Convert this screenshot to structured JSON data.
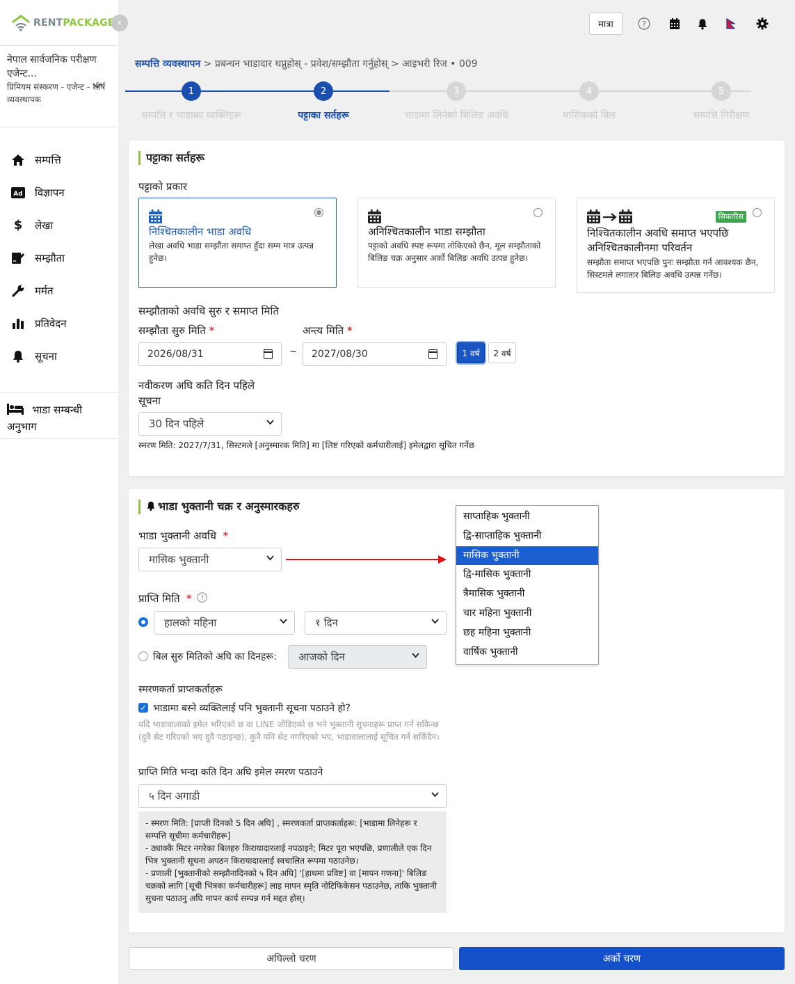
{
  "app": {
    "logo_rent": "RENT",
    "logo_package": "PACKAGE",
    "collapse_glyph": "‹",
    "trip_button": "मात्रा"
  },
  "org": {
    "name": "नेपाल सार्वजनिक परीक्षण एजेन्ट...",
    "plan": "प्रिमियम संस्करण - एजेन्ट - शीर्ष व्यवस्थापक"
  },
  "nav": [
    {
      "label": "सम्पत्ति",
      "icon": "home-icon"
    },
    {
      "label": "विज्ञापन",
      "icon": "ad-icon"
    },
    {
      "label": "लेखा",
      "icon": "dollar-icon"
    },
    {
      "label": "सम्झौता",
      "icon": "contract-icon"
    },
    {
      "label": "मर्मत",
      "icon": "wrench-icon"
    },
    {
      "label": "प्रतिवेदन",
      "icon": "bar-chart-icon"
    },
    {
      "label": "सूचना",
      "icon": "bell-icon"
    }
  ],
  "nav_extra": {
    "label": "भाडा सम्बन्धी अनुभाग",
    "icon": "bed-icon"
  },
  "breadcrumb": {
    "root": "सम्पत्ति व्यवस्थापन",
    "rest": " > प्रबन्धन भाडादार थप्नुहोस् - प्रवेश/सम्झौता गर्नुहोस् > आइभरी रिज • 009"
  },
  "steps": [
    {
      "num": "1",
      "label": "सम्पत्ति र भाडाका व्यक्तिहरू",
      "state": "done"
    },
    {
      "num": "2",
      "label": "पट्टाका सर्तहरू",
      "state": "active"
    },
    {
      "num": "3",
      "label": "भाडामा लिनेको बिलिङ अवधि",
      "state": "pending"
    },
    {
      "num": "4",
      "label": "मासिकको बिल",
      "state": "pending"
    },
    {
      "num": "5",
      "label": "सम्पत्ति निरीक्षण",
      "state": "pending"
    }
  ],
  "lease": {
    "title": "पट्टाका सर्तहरू",
    "type_label": "पट्टाको प्रकार",
    "options": [
      {
        "title": "निश्चितकालीन भाडा अवधि",
        "desc": "लेखा अवधि भाडा सम्झौता समाप्त हुँदा सम्म मात्र उत्पन्न हुनेछ।",
        "selected": true
      },
      {
        "title": "अनिश्चितकालीन भाडा सम्झौता",
        "desc": "पट्टाको अवधि स्पष्ट रूपमा तोकिएको छैन, मूल सम्झौताको बिलिङ चक्र अनुसार अर्को बिलिङ अवधि उत्पन्न हुनेछ।",
        "selected": false
      },
      {
        "title": "निश्चितकालीन अवधि समाप्त भएपछि अनिश्चितकालीनमा परिवर्तन",
        "desc": "सम्झौता समाप्त भएपछि पुनः सम्झौता गर्न आवश्यक छैन, सिस्टमले लगातार बिलिङ अवधि उत्पन्न गर्नेछ।",
        "selected": false,
        "badge": "सिफारिस"
      }
    ],
    "period_label": "सम्झौताको अवधि सुरु र समाप्त मिति",
    "start_label": "सम्झौता सुरु मिति",
    "end_label": "अन्त्य मिति",
    "start_value": "2026/08/31",
    "end_value": "2027/08/30",
    "tilde": "~",
    "year1": "1 वर्ष",
    "year2": "2 वर्ष",
    "renewal_label": "नवीकरण अघि कति दिन पहिले सूचना",
    "renewal_value": "30 दिन पहिले",
    "reminder_note": "स्मरण मिति: 2027/7/31, सिस्टमले [अनुस्मारक मिति] मा [लिष्ट गरिएको कर्मचारीलाई] इमेलद्वारा सूचित गर्नेछ"
  },
  "payment": {
    "title": "भाडा भुक्तानी चक्र र अनुस्मारकहरु",
    "period_label": "भाडा भुक्तानी अवधि",
    "period_value": "मासिक भुक्तानी",
    "receive_label": "प्राप्ति मिति",
    "receive_month": "हालको महिना",
    "receive_day": "१ दिन",
    "before_label": "बिल सुरु मितिको अघि का दिनहरू:",
    "before_value": "आजको दिन",
    "recipients_label": "स्मरणकर्ता प्राप्तकर्ताहरू",
    "notify_tenant": "भाडामा बस्ने व्यक्तिलाई पनि भुक्तानी सूचना पठाउने हो?",
    "notify_help": "यदि भाडावालाको इमेल भरिएको छ वा LINE जोडिएको छ भने भुक्तानी सूचनाहरू प्राप्त गर्न सकिन्छ (दुवै सेट गरिएको भए दुवै पठाइन्छ); कुनै पनि सेट नगरिएको भए, भाडावालालाई सूचित गर्न सकिँदैन।",
    "email_days_label": "प्राप्ति मिति भन्दा कति दिन अघि इमेल स्मरण पठाउने",
    "email_days_value": "५ दिन अगाडी",
    "info_lines": [
      "- स्मरण मिति: [प्राप्ती दिनको 5 दिन अघि] , स्मरणकर्ता प्राप्तकर्ताहरू: [भाडामा लिनेहरू र सम्पत्ति सूचीमा कर्मचारीहरू]",
      "- ठ्याक्कै मिटर नगरेका बिलहरु किरायादारलाई नपठाइने; मिटर पूरा भएपछि, प्रणालीले एक दिन भित्र भुक्तानी सूचना अपठन किरायादारलाई स्वचालित रूपमा पठाउनेछ।",
      "- प्रणाली [भुक्तानीको सम्झौनादिनको ५ दिन अघि] '[हाथमा प्रविष्ट] वा [मापन गणना]' बिलिङ चक्रको लागि [सूची भित्रका कर्मचारीहरू] लाइ मापन स्मृति नोटिफिकेसन पठाउनेछ, ताकि भुक्तानी सुचना पठाउनु अघि मापन कार्य सम्पन्न गर्न मद्दत होस्।"
    ],
    "dropdown_options": [
      "साप्ताहिक भुक्तानी",
      "द्वि-साप्ताहिक भुक्तानी",
      "मासिक भुक्तानी",
      "द्वि-मासिक भुक्तानी",
      "त्रैमासिक भुक्तानी",
      "चार महिना भुक्तानी",
      "छह महिना भुक्तानी",
      "वार्षिक भुक्तानी"
    ],
    "dropdown_selected": "मासिक भुक्तानी"
  },
  "footer": {
    "prev": "अघिल्लो चरण",
    "next": "अर्को चरण"
  },
  "colors": {
    "primary": "#1a4fb0",
    "accent_green": "#8cc63f",
    "step_pending": "#d6d6d6"
  }
}
